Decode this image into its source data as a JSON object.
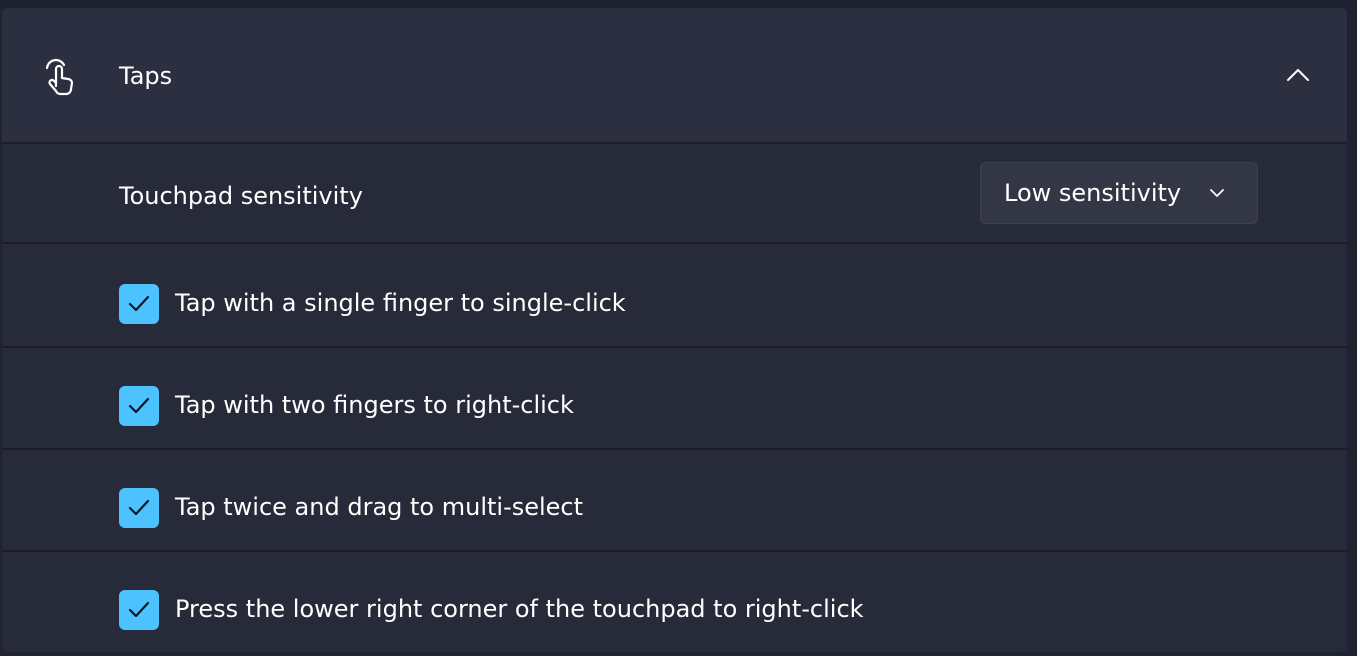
{
  "section": {
    "title": "Taps",
    "icon": "hand-tap-icon",
    "expanded": true
  },
  "sensitivity": {
    "label": "Touchpad sensitivity",
    "selected": "Low sensitivity"
  },
  "options": [
    {
      "label": "Tap with a single finger to single-click",
      "checked": true
    },
    {
      "label": "Tap with two fingers to right-click",
      "checked": true
    },
    {
      "label": "Tap twice and drag to multi-select",
      "checked": true
    },
    {
      "label": "Press the lower right corner of the touchpad to right-click",
      "checked": true
    }
  ],
  "colors": {
    "accent": "#4cc2ff",
    "panel": "#272a38",
    "header": "#2b2f3f"
  }
}
